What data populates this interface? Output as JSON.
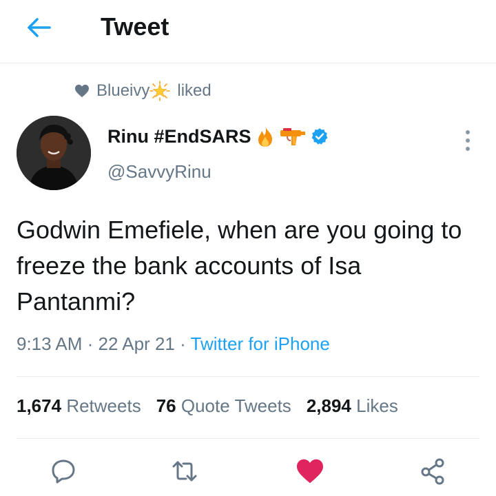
{
  "header": {
    "title": "Tweet",
    "back_icon": "arrow-left-icon"
  },
  "social_context": {
    "user": "Blueivy",
    "action": "liked",
    "icon": "heart-icon"
  },
  "author": {
    "display_name": "Rinu #EndSARS",
    "handle": "@SavvyRinu",
    "verified": true,
    "emojis": [
      "fire-emoji",
      "water-gun-emoji"
    ]
  },
  "tweet": {
    "text": "Godwin Emefiele, when are you going to freeze the bank accounts of Isa Pantanmi?",
    "time": "9:13 AM",
    "date": "22 Apr 21",
    "source": "Twitter for iPhone",
    "sep": "·"
  },
  "stats": {
    "retweets_count": "1,674",
    "retweets_label": "Retweets",
    "quotes_count": "76",
    "quotes_label": "Quote Tweets",
    "likes_count": "2,894",
    "likes_label": "Likes"
  },
  "colors": {
    "accent": "#1da1f2",
    "like": "#e0245e",
    "muted": "#657786",
    "text": "#14171a"
  }
}
